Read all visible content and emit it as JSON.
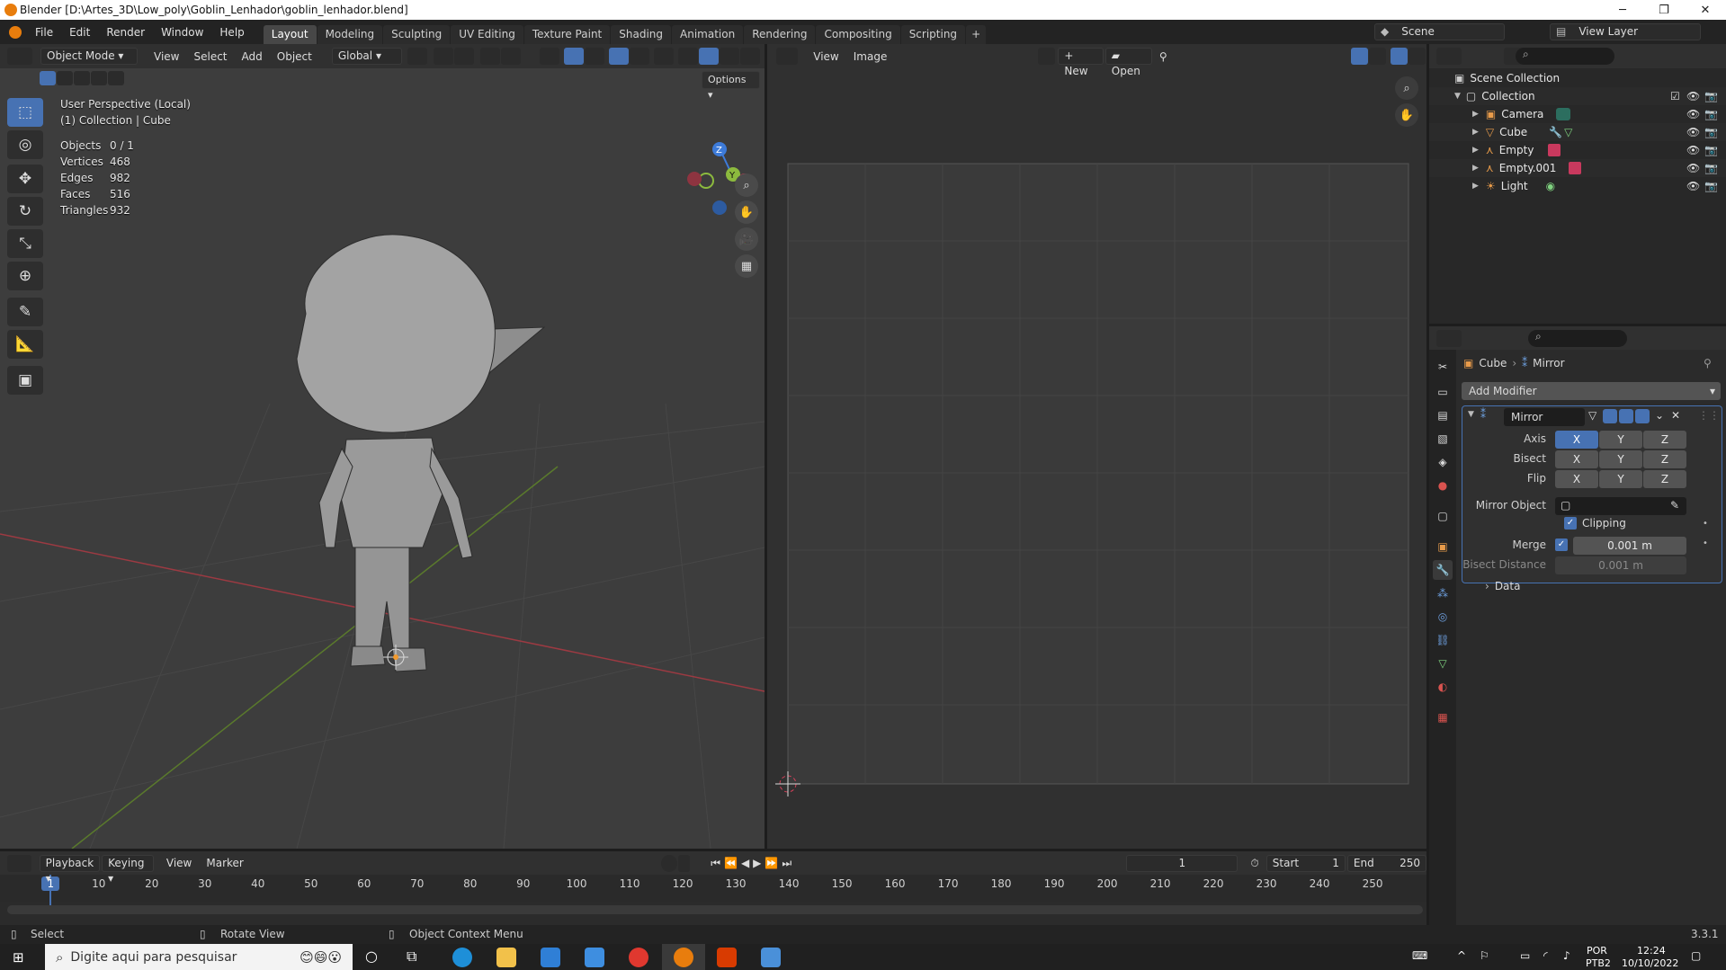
{
  "window": {
    "title": "Blender [D:\\Artes_3D\\Low_poly\\Goblin_Lenhador\\goblin_lenhador.blend]",
    "minimize": "─",
    "maximize": "❐",
    "close": "✕"
  },
  "menus": [
    "File",
    "Edit",
    "Render",
    "Window",
    "Help"
  ],
  "workspaces": [
    {
      "label": "Layout",
      "active": true
    },
    {
      "label": "Modeling"
    },
    {
      "label": "Sculpting"
    },
    {
      "label": "UV Editing"
    },
    {
      "label": "Texture Paint"
    },
    {
      "label": "Shading"
    },
    {
      "label": "Animation"
    },
    {
      "label": "Rendering"
    },
    {
      "label": "Compositing"
    },
    {
      "label": "Scripting"
    }
  ],
  "add_workspace": "+",
  "scene": {
    "label": "Scene",
    "view_layer": "View Layer"
  },
  "viewport": {
    "mode": "Object Mode",
    "menu": [
      "View",
      "Select",
      "Add",
      "Object"
    ],
    "orientation": "Global",
    "options": "Options",
    "info_line1": "User Perspective (Local)",
    "info_line2": "(1) Collection | Cube",
    "stats": [
      {
        "label": "Objects",
        "value": "0 / 1"
      },
      {
        "label": "Vertices",
        "value": "468"
      },
      {
        "label": "Edges",
        "value": "982"
      },
      {
        "label": "Faces",
        "value": "516"
      },
      {
        "label": "Triangles",
        "value": "932"
      }
    ],
    "gizmo": {
      "z": "Z",
      "y": "Y",
      "x": "X"
    }
  },
  "image_editor": {
    "menu": [
      "View",
      "Image"
    ],
    "new": "New",
    "open": "Open"
  },
  "outliner": {
    "scene_collection": "Scene Collection",
    "collection": "Collection",
    "items": [
      {
        "label": "Camera",
        "color": "#7fb4a8"
      },
      {
        "label": "Cube",
        "color": "#e89b4a"
      },
      {
        "label": "Empty",
        "color": "#e89b4a"
      },
      {
        "label": "Empty.001",
        "color": "#e89b4a"
      },
      {
        "label": "Light",
        "color": "#e89b4a"
      }
    ]
  },
  "properties": {
    "breadcrumb_object": "Cube",
    "breadcrumb_modifier": "Mirror",
    "add_modifier": "Add Modifier",
    "modifier_name": "Mirror",
    "axis_label": "Axis",
    "bisect_label": "Bisect",
    "flip_label": "Flip",
    "x": "X",
    "y": "Y",
    "z": "Z",
    "mirror_object_label": "Mirror Object",
    "clipping_label": "Clipping",
    "merge_label": "Merge",
    "merge_value": "0.001 m",
    "bisect_distance_label": "Bisect Distance",
    "bisect_distance_value": "0.001 m",
    "data_label": "Data"
  },
  "timeline": {
    "menu": [
      "Playback",
      "Keying",
      "View",
      "Marker"
    ],
    "current_frame": "1",
    "start_label": "Start",
    "start_value": "1",
    "end_label": "End",
    "end_value": "250",
    "ticks": [
      "1",
      "10",
      "20",
      "30",
      "40",
      "50",
      "60",
      "70",
      "80",
      "90",
      "100",
      "110",
      "120",
      "130",
      "140",
      "150",
      "160",
      "170",
      "180",
      "190",
      "200",
      "210",
      "220",
      "230",
      "240",
      "250"
    ]
  },
  "statusbar": {
    "select": "Select",
    "rotate": "Rotate View",
    "context": "Object Context Menu",
    "version": "3.3.1"
  },
  "taskbar": {
    "search_placeholder": "Digite aqui para pesquisar",
    "lang1": "POR",
    "lang2": "PTB2",
    "time": "12:24",
    "date": "10/10/2022"
  },
  "colors": {
    "accent": "#4772b3",
    "blender_orange": "#e87d0d",
    "x_axis": "#d5405a",
    "y_axis": "#8cba3e",
    "z_axis": "#3d7bd9"
  }
}
